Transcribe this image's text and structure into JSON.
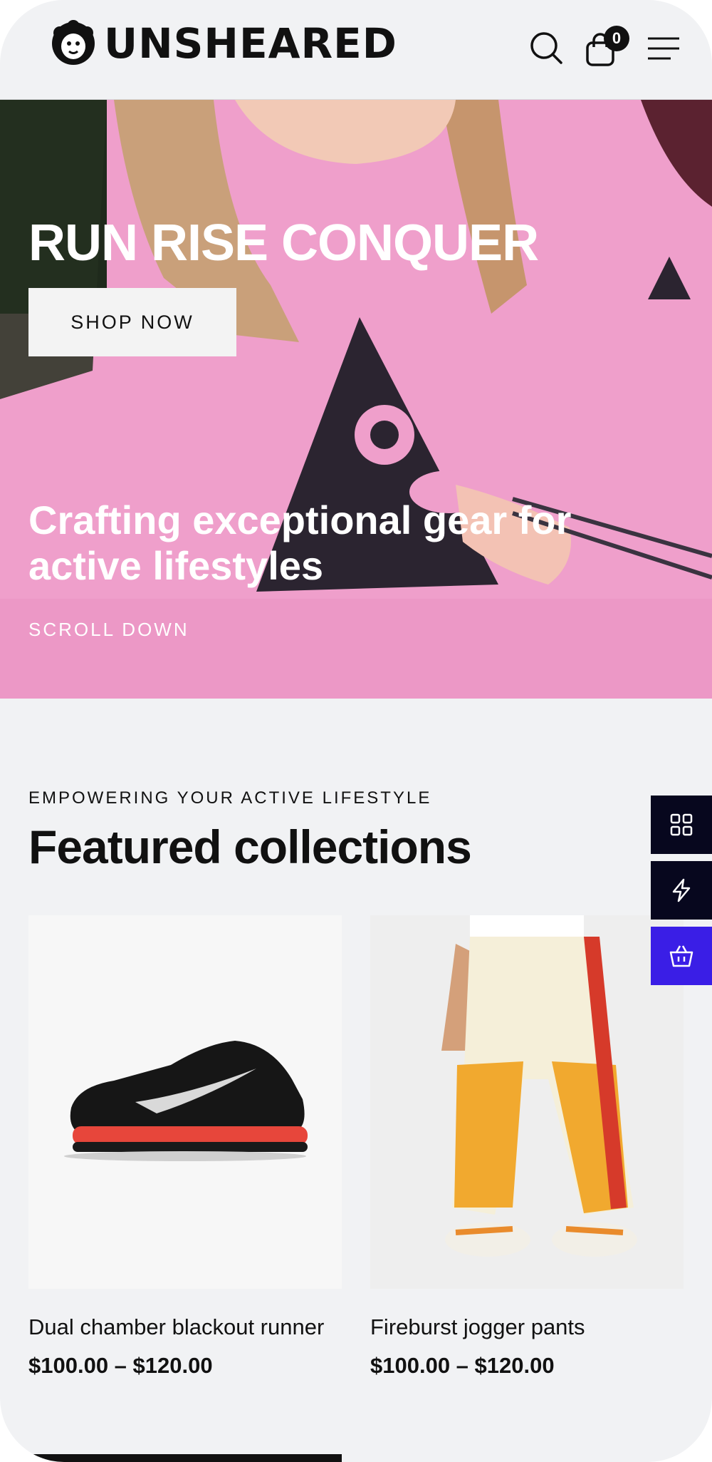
{
  "header": {
    "brand": "UNSHEARED",
    "cart_count": "0",
    "icons": [
      "sheep-logo-icon",
      "search-icon",
      "shopping-bag-icon",
      "hamburger-menu-icon"
    ]
  },
  "hero": {
    "title": "RUN RISE CONQUER",
    "cta_label": "SHOP NOW",
    "subtitle": "Crafting exceptional gear for active lifestyles",
    "scroll_label": "SCROLL DOWN"
  },
  "featured": {
    "eyebrow": "EMPOWERING YOUR ACTIVE LIFESTYLE",
    "title": "Featured collections",
    "products": [
      {
        "name": "Dual chamber blackout runner",
        "price": "$100.00 – $120.00",
        "image": "black-sneaker"
      },
      {
        "name": "Fireburst jogger pants",
        "price": "$100.00 – $120.00",
        "image": "yellow-track-pants"
      }
    ]
  },
  "side_panel": {
    "icons": [
      "grid-icon",
      "lightning-icon",
      "basket-icon"
    ]
  },
  "colors": {
    "background": "#f1f2f4",
    "accent": "#3a1ee6",
    "dark": "#07071e",
    "hero_pink": "#ee9fcc"
  }
}
